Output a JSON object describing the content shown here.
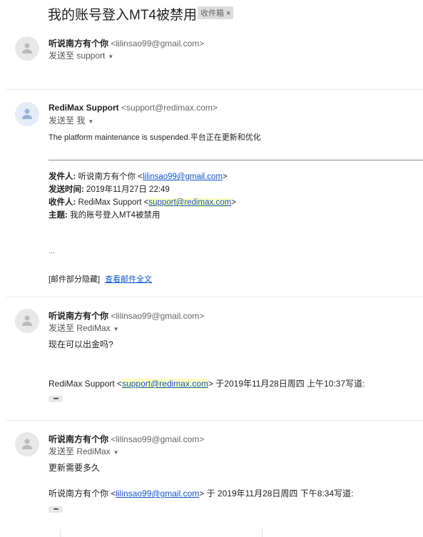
{
  "subject": "我的账号登入MT4被禁用",
  "label_chip": {
    "label": "收件箱",
    "close": "×"
  },
  "messages": [
    {
      "sender_name": "听说南方有个你",
      "sender_email": "<lilinsao99@gmail.com>",
      "to": "发送至 support"
    },
    {
      "sender_name": "RediMax Support",
      "sender_email": "<support@redimax.com>",
      "to": "发送至 我",
      "body": "The platform maintenance is suspended.平台正在更新和优化",
      "quote": {
        "from_label": "发件人:",
        "from_name": "听说南方有个你 <",
        "from_email": "lilinsao99@gmail.com",
        "from_end": ">",
        "time_label": "发送时间:",
        "time_value": "2019年11月27日 22:49",
        "to_label": "收件人:",
        "to_name": "RediMax Support <",
        "to_email": "support@redimax.com",
        "to_end": ">",
        "subj_label": "主题:",
        "subj_value": "我的账号登入MT4被禁用"
      },
      "dots": "...",
      "hidden_note": "[邮件部分隐藏]",
      "view_full": "查看邮件全文"
    },
    {
      "sender_name": "听说南方有个你",
      "sender_email": "<lilinsao99@gmail.com>",
      "to": "发送至 RediMax",
      "body": "现在可以出金吗?",
      "reply_prefix": "RediMax Support <",
      "reply_email": "support@redimax.com",
      "reply_suffix": "> 于2019年11月28日周四 上午10:37写道:",
      "more": "•••"
    },
    {
      "sender_name": "听说南方有个你",
      "sender_email": "<lilinsao99@gmail.com>",
      "to": "发送至 RediMax",
      "body": "更新需要多久",
      "reply_prefix": "听说南方有个你 <",
      "reply_email": "lilinsao99@gmail.com",
      "reply_suffix": "> 于 2019年11月28日周四 下午8:34写道:",
      "more": "•••"
    }
  ],
  "icons": {
    "avatar": "person-icon",
    "caret": "chevron-down-icon"
  },
  "colors": {
    "link": "#1155cc",
    "highlight": "#ffffc0",
    "avatar_blue": "#e3ecf7"
  }
}
